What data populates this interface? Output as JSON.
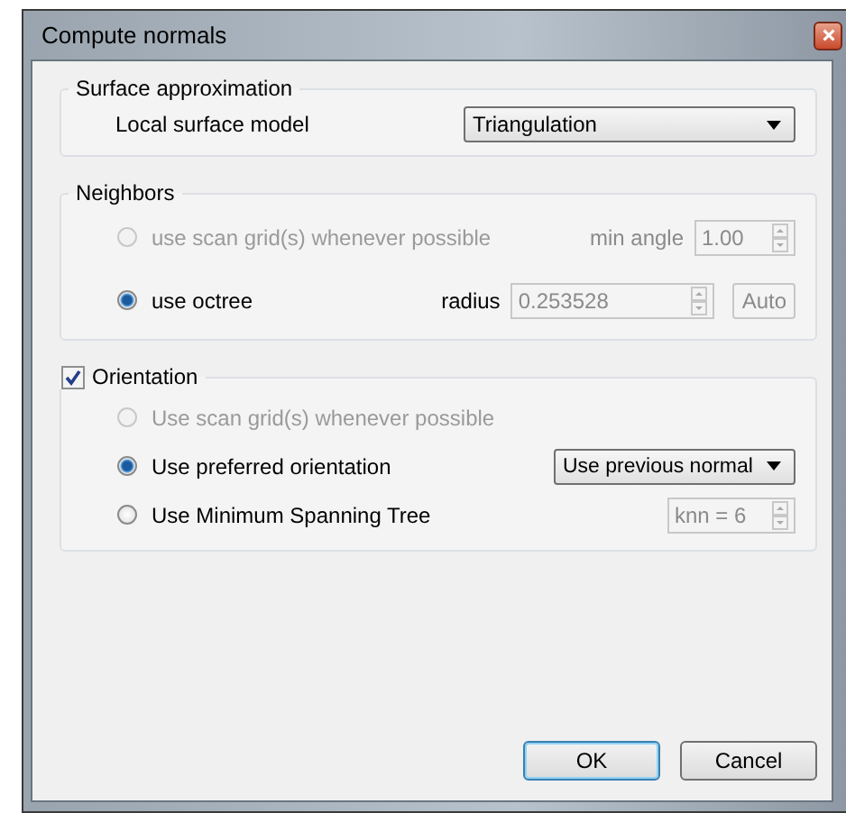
{
  "window": {
    "title": "Compute normals"
  },
  "surface_approximation": {
    "title": "Surface approximation",
    "label": "Local surface model",
    "value": "Triangulation"
  },
  "neighbors": {
    "title": "Neighbors",
    "options": [
      {
        "label": "use scan grid(s) whenever possible",
        "selected": false,
        "disabled": true,
        "control": {
          "kind": "spinbox",
          "label": "min angle",
          "label_disabled": true,
          "value": "1.00"
        }
      },
      {
        "label": "use octree",
        "selected": true,
        "disabled": false,
        "control": {
          "kind": "spinbox",
          "label": "radius",
          "label_disabled": false,
          "value": "0.253528",
          "button": "Auto"
        }
      }
    ]
  },
  "orientation": {
    "title": "Orientation",
    "checked": true,
    "options": [
      {
        "label": "Use scan grid(s) whenever possible",
        "selected": false,
        "disabled": true
      },
      {
        "label": "Use preferred orientation",
        "selected": true,
        "disabled": false,
        "control": {
          "kind": "dropdown",
          "value": "Use previous normal"
        }
      },
      {
        "label": "Use Minimum Spanning Tree",
        "selected": false,
        "disabled": false,
        "control": {
          "kind": "spinbox",
          "value": "knn = 6"
        }
      }
    ]
  },
  "buttons": [
    {
      "label": "OK",
      "default": true
    },
    {
      "label": "Cancel",
      "default": false
    }
  ]
}
